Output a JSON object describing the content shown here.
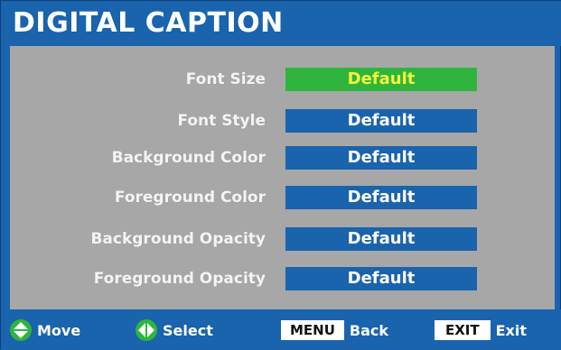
{
  "header": {
    "title": "DIGITAL CAPTION"
  },
  "menu": {
    "items": [
      {
        "label": "Font Size",
        "value": "Default",
        "selected": true
      },
      {
        "label": "Font Style",
        "value": "Default",
        "selected": false
      },
      {
        "label": "Background Color",
        "value": "Default",
        "selected": false
      },
      {
        "label": "Foreground Color",
        "value": "Default",
        "selected": false
      },
      {
        "label": "Background Opacity",
        "value": "Default",
        "selected": false
      },
      {
        "label": "Foreground Opacity",
        "value": "Default",
        "selected": false
      }
    ]
  },
  "footer": {
    "move": {
      "icon": "up-down-arrow-icon",
      "label": "Move"
    },
    "select": {
      "icon": "left-right-arrow-icon",
      "label": "Select"
    },
    "back": {
      "key": "MENU",
      "label": "Back"
    },
    "exit": {
      "key": "EXIT",
      "label": "Exit"
    }
  },
  "colors": {
    "background": "#1a63ad",
    "panel": "#a7a7a7",
    "highlight": "#2fb53e",
    "highlight_text": "#f5f53a"
  }
}
